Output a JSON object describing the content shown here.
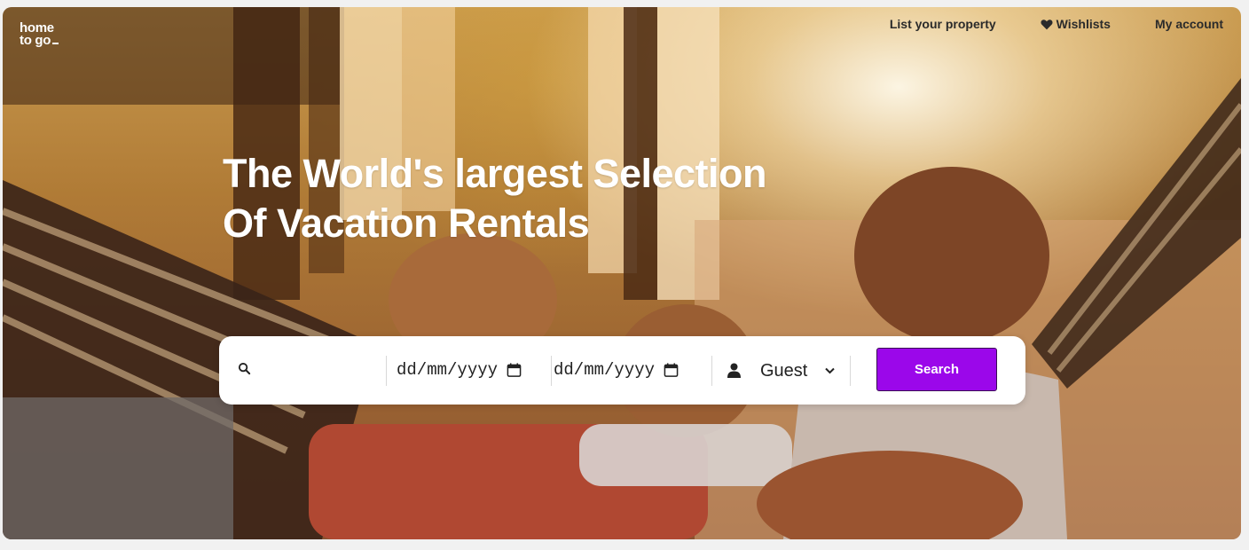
{
  "brand": {
    "logo_line1": "home",
    "logo_line2": "to go"
  },
  "nav": {
    "list_property": "List your property",
    "wishlists": "Wishlists",
    "my_account": "My account"
  },
  "hero": {
    "headline_line1": "The World's largest Selection",
    "headline_line2": "Of Vacation Rentals"
  },
  "search": {
    "destination_placeholder": "",
    "checkin_placeholder": "dd/mm/yyyy",
    "checkout_placeholder": "dd/mm/yyyy",
    "guest_selected": "Guest",
    "button_label": "Search"
  },
  "colors": {
    "accent": "#9b07ea",
    "nav_text": "#2b2b2b"
  },
  "icons": [
    "search-icon",
    "calendar-icon",
    "person-icon",
    "heart-icon",
    "chevron-down-icon"
  ]
}
